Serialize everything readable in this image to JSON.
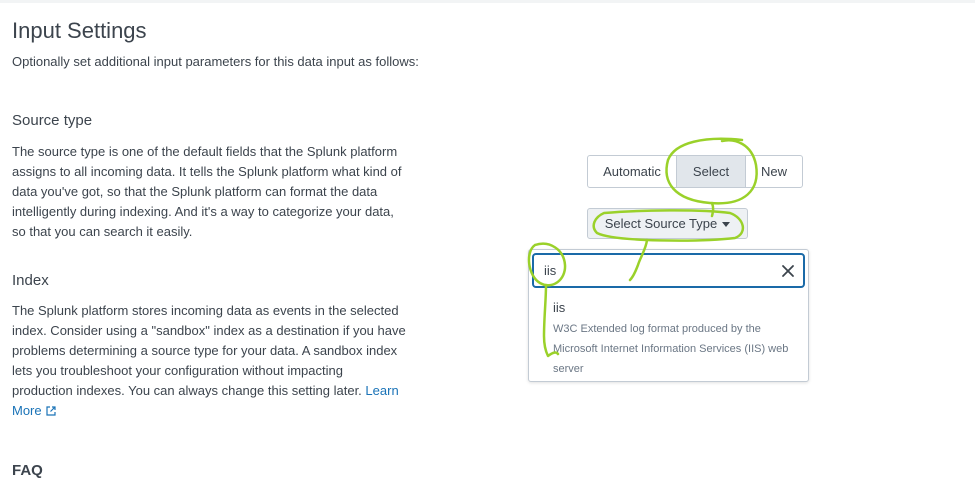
{
  "page": {
    "title": "Input Settings",
    "subtitle": "Optionally set additional input parameters for this data input as follows:"
  },
  "source_type": {
    "heading": "Source type",
    "description": "The source type is one of the default fields that the Splunk platform assigns to all incoming data. It tells the Splunk platform what kind of data you've got, so that the Splunk platform can format the data intelligently during indexing. And it's a way to categorize your data, so that you can search it easily.",
    "toggle": {
      "options": [
        "Automatic",
        "Select",
        "New"
      ],
      "selected": "Select"
    },
    "select_button_label": "Select Source Type",
    "dropdown": {
      "search_value": "iis",
      "clear_icon": "close-icon",
      "results": [
        {
          "name": "iis",
          "description": "W3C Extended log format produced by the Microsoft Internet Information Services (IIS) web server"
        }
      ]
    }
  },
  "index": {
    "heading": "Index",
    "description": "The Splunk platform stores incoming data as events in the selected index. Consider using a \"sandbox\" index as a destination if you have problems determining a source type for your data. A sandbox index lets you troubleshoot your configuration without impacting production indexes. You can always change this setting later.",
    "learn_more_label": "Learn More",
    "learn_more_icon": "external-link-icon"
  },
  "faq": {
    "heading": "FAQ"
  },
  "colors": {
    "text": "#3c444d",
    "link": "#1a73b7",
    "focus_border": "#1a6aa8",
    "selected_toggle_bg": "#e1e6eb",
    "annotation": "#9ad12a"
  }
}
